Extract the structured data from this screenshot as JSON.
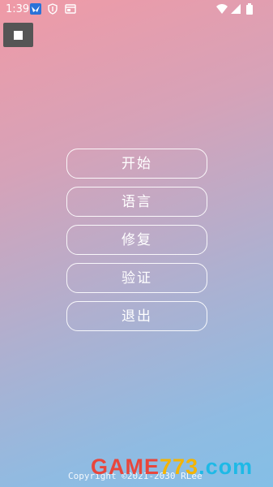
{
  "status_bar": {
    "time": "1:39",
    "icons": [
      "notification-bird-icon",
      "shield-app-icon",
      "screen-cast-icon",
      "wifi-icon",
      "signal-icon",
      "battery-icon"
    ]
  },
  "stop_button": {
    "icon": "stop-icon"
  },
  "menu": {
    "items": [
      {
        "label": "开始"
      },
      {
        "label": "语言"
      },
      {
        "label": "修复"
      },
      {
        "label": "验证"
      },
      {
        "label": "退出"
      }
    ]
  },
  "footer": {
    "copyright": "Copyright ©2021-2030 RLee",
    "watermark_main": "GAME",
    "watermark_num": "773",
    "watermark_domain": ".com"
  },
  "colors": {
    "gradient_top": "#f09aa6",
    "gradient_bottom": "#84bfe6",
    "button_border": "#ffffff",
    "stop_button_bg": "#555555"
  }
}
